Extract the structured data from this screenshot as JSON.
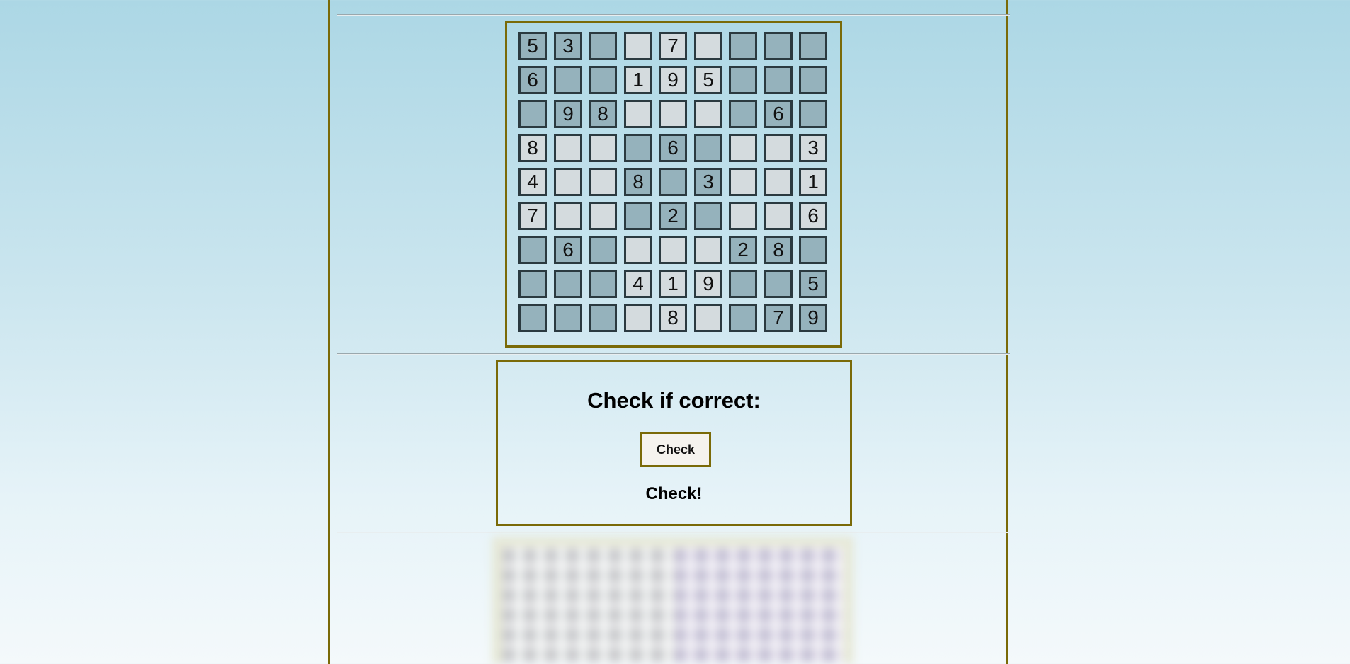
{
  "board": {
    "rows": [
      [
        "5",
        "3",
        "",
        "",
        "7",
        "",
        "",
        "",
        ""
      ],
      [
        "6",
        "",
        "",
        "1",
        "9",
        "5",
        "",
        "",
        ""
      ],
      [
        "",
        "9",
        "8",
        "",
        "",
        "",
        "",
        "6",
        ""
      ],
      [
        "8",
        "",
        "",
        "",
        "6",
        "",
        "",
        "",
        "3"
      ],
      [
        "4",
        "",
        "",
        "8",
        "",
        "3",
        "",
        "",
        "1"
      ],
      [
        "7",
        "",
        "",
        "",
        "2",
        "",
        "",
        "",
        "6"
      ],
      [
        "",
        "6",
        "",
        "",
        "",
        "",
        "2",
        "8",
        ""
      ],
      [
        "",
        "",
        "",
        "4",
        "1",
        "9",
        "",
        "",
        "5"
      ],
      [
        "",
        "",
        "",
        "",
        "8",
        "",
        "",
        "7",
        "9"
      ]
    ]
  },
  "check": {
    "title": "Check if correct:",
    "button_label": "Check",
    "result_text": "Check!"
  },
  "colors": {
    "frame": "#7a6a08",
    "dark_box": "#95b2bc",
    "light_box": "#d4dbde"
  }
}
